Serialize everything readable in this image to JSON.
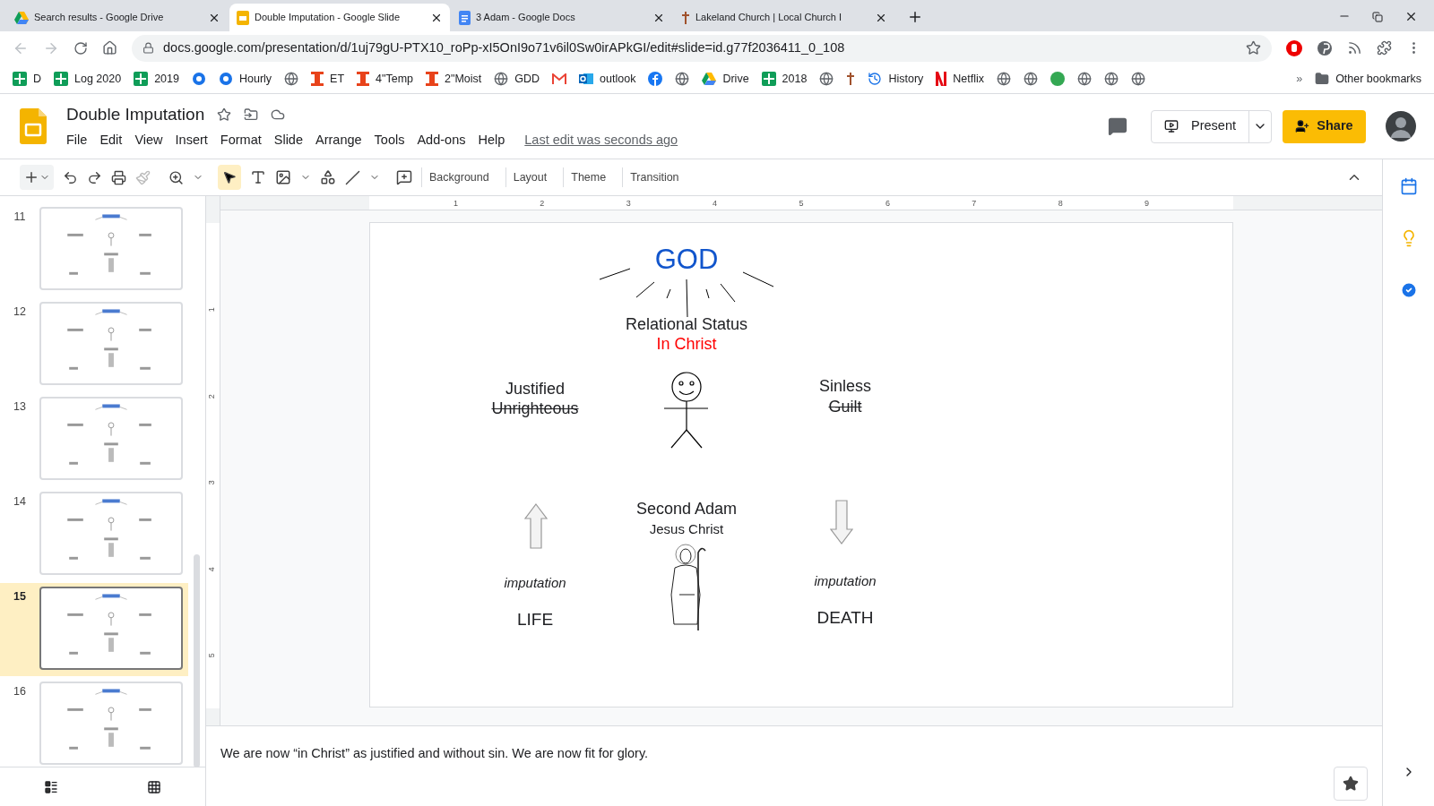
{
  "browser": {
    "tabs": [
      {
        "title": "Search results - Google Drive",
        "kind": "drive",
        "selected": false
      },
      {
        "title": "Double Imputation - Google Slide",
        "kind": "slides",
        "selected": true
      },
      {
        "title": "3 Adam - Google Docs",
        "kind": "docs",
        "selected": false
      },
      {
        "title": "Lakeland Church | Local Church I",
        "kind": "cross",
        "selected": false
      }
    ],
    "address": "docs.google.com/presentation/d/1uj79gU-PTX10_roPp-xI5OnI9o71v6il0Sw0irAPkGI/edit#slide=id.g77f2036411_0_108",
    "bookmarks": [
      {
        "kind": "sheet",
        "label": "D"
      },
      {
        "kind": "sheet",
        "label": "Log 2020"
      },
      {
        "kind": "sheet",
        "label": "2019"
      },
      {
        "kind": "badge"
      },
      {
        "kind": "badge",
        "label": "Hourly"
      },
      {
        "kind": "globe"
      },
      {
        "kind": "bar",
        "label": "ET"
      },
      {
        "kind": "bar",
        "label": "4\"Temp"
      },
      {
        "kind": "bar",
        "label": "2\"Moist"
      },
      {
        "kind": "globe",
        "label": "GDD"
      },
      {
        "kind": "mail"
      },
      {
        "kind": "outlook",
        "label": "outlook"
      },
      {
        "kind": "facebook"
      },
      {
        "kind": "globe"
      },
      {
        "kind": "drive",
        "label": "Drive"
      },
      {
        "kind": "sheet",
        "label": "2018"
      },
      {
        "kind": "globe"
      },
      {
        "kind": "cross"
      },
      {
        "kind": "history",
        "label": "History"
      },
      {
        "kind": "netflix",
        "label": "Netflix"
      },
      {
        "kind": "globe"
      },
      {
        "kind": "globe"
      },
      {
        "kind": "dot"
      },
      {
        "kind": "globe"
      },
      {
        "kind": "globe"
      },
      {
        "kind": "globe"
      }
    ],
    "more": "»",
    "other": "Other bookmarks"
  },
  "app": {
    "title": "Double Imputation",
    "menu": [
      "File",
      "Edit",
      "View",
      "Insert",
      "Format",
      "Slide",
      "Arrange",
      "Tools",
      "Add-ons",
      "Help"
    ],
    "last_edit": "Last edit was seconds ago",
    "present": "Present",
    "share": "Share"
  },
  "toolbar": {
    "buttons": [
      "Background",
      "Layout",
      "Theme",
      "Transition"
    ]
  },
  "ruler": {
    "horizontal": [
      "1",
      "2",
      "3",
      "4",
      "5",
      "6",
      "7",
      "8",
      "9"
    ],
    "vertical": [
      "1",
      "2",
      "3",
      "4",
      "5"
    ]
  },
  "thumbnails": [
    {
      "number": "11",
      "selected": false
    },
    {
      "number": "12",
      "selected": false
    },
    {
      "number": "13",
      "selected": false
    },
    {
      "number": "14",
      "selected": false
    },
    {
      "number": "15",
      "selected": true
    },
    {
      "number": "16",
      "selected": false
    }
  ],
  "slide": {
    "title": {
      "text": "GOD",
      "color": "#1155cc"
    },
    "relation": {
      "label": "Relational Status",
      "status": {
        "text": "In Christ",
        "color": "#ff0000"
      }
    },
    "left": {
      "label": "Justified",
      "former": {
        "text": "Unrighteous",
        "struck": true
      },
      "caption": "imputation",
      "result": "LIFE"
    },
    "right": {
      "label": "Sinless",
      "former": {
        "text": "Guilt",
        "struck": true
      },
      "caption": "imputation",
      "result": "DEATH"
    },
    "center": {
      "name": "Second Adam",
      "subtitle": "Jesus Christ"
    }
  },
  "notes": "We are now “in Christ” as justified and without sin. We are now fit for glory."
}
